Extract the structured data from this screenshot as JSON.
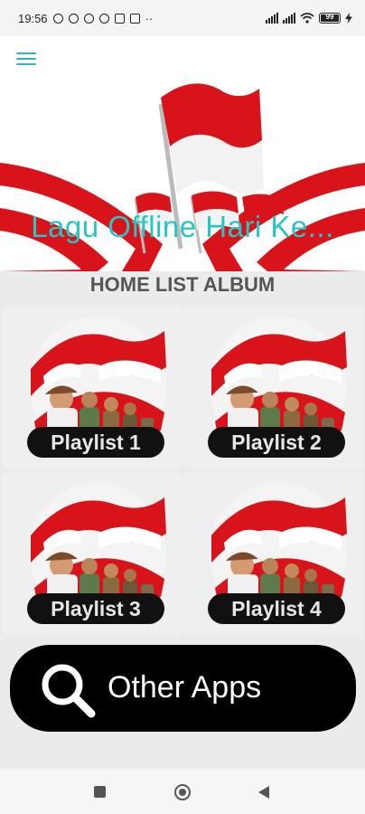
{
  "status_bar": {
    "time": "19:56",
    "dots": "··",
    "battery_level": "99",
    "notification_icons": [
      "moon-icon",
      "brightness-icon",
      "alarm-icon",
      "data-saver-icon",
      "trash-icon",
      "youtube-icon"
    ]
  },
  "header": {
    "app_title": "Lagu Offline Hari Ke..."
  },
  "home": {
    "section_title": "HOME LIST ALBUM",
    "albums": [
      {
        "label": "Playlist 1"
      },
      {
        "label": "Playlist 2"
      },
      {
        "label": "Playlist 3"
      },
      {
        "label": "Playlist 4"
      }
    ]
  },
  "other_apps": {
    "label": "Other Apps",
    "icon": "search-icon"
  },
  "colors": {
    "accent": "#26c6c6",
    "flag_red": "#d8141a",
    "flag_white": "#ffffff",
    "button_bg": "#000000"
  }
}
